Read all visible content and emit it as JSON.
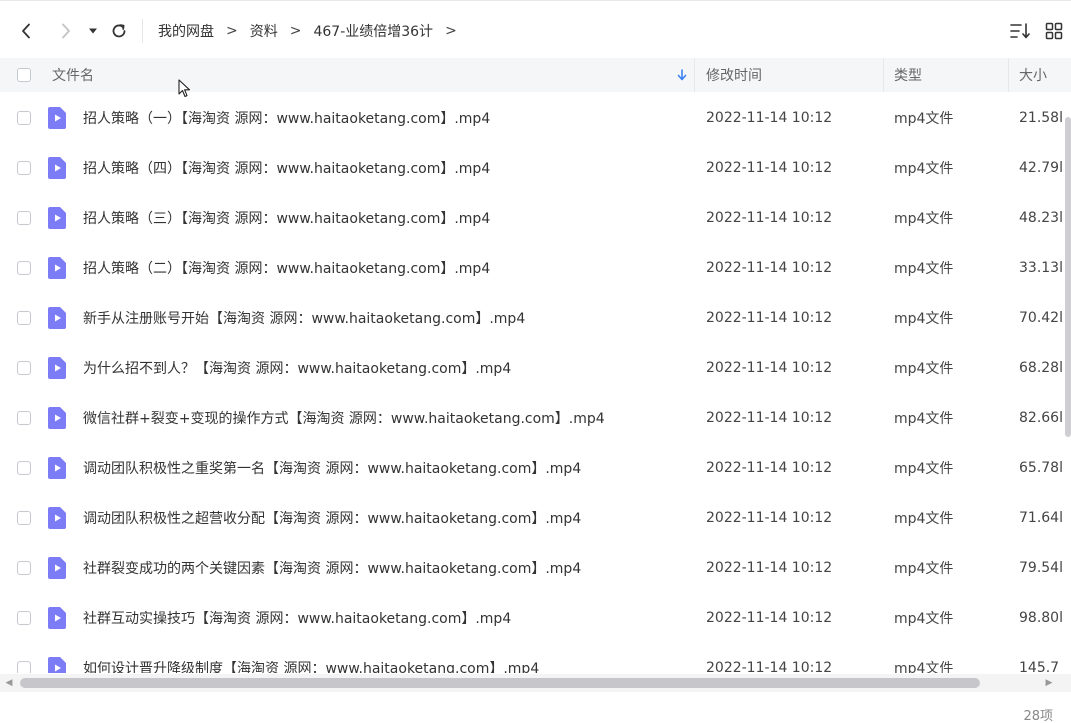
{
  "toolbar": {
    "breadcrumb": [
      "我的网盘",
      "资料",
      "467-业绩倍增36计"
    ],
    "separator": ">"
  },
  "columns": {
    "name": "文件名",
    "modified": "修改时间",
    "type": "类型",
    "size": "大小"
  },
  "files": [
    {
      "name": "招人策略（一）【海淘资 源网：www.haitaoketang.com】.mp4",
      "modified": "2022-11-14 10:12",
      "type": "mp4文件",
      "size": "21.58l"
    },
    {
      "name": "招人策略（四）【海淘资 源网：www.haitaoketang.com】.mp4",
      "modified": "2022-11-14 10:12",
      "type": "mp4文件",
      "size": "42.79l"
    },
    {
      "name": "招人策略（三）【海淘资 源网：www.haitaoketang.com】.mp4",
      "modified": "2022-11-14 10:12",
      "type": "mp4文件",
      "size": "48.23l"
    },
    {
      "name": "招人策略（二）【海淘资 源网：www.haitaoketang.com】.mp4",
      "modified": "2022-11-14 10:12",
      "type": "mp4文件",
      "size": "33.13l"
    },
    {
      "name": "新手从注册账号开始【海淘资 源网：www.haitaoketang.com】.mp4",
      "modified": "2022-11-14 10:12",
      "type": "mp4文件",
      "size": "70.42l"
    },
    {
      "name": "为什么招不到人？【海淘资 源网：www.haitaoketang.com】.mp4",
      "modified": "2022-11-14 10:12",
      "type": "mp4文件",
      "size": "68.28l"
    },
    {
      "name": "微信社群+裂变+变现的操作方式【海淘资 源网：www.haitaoketang.com】.mp4",
      "modified": "2022-11-14 10:12",
      "type": "mp4文件",
      "size": "82.66l"
    },
    {
      "name": "调动团队积极性之重奖第一名【海淘资 源网：www.haitaoketang.com】.mp4",
      "modified": "2022-11-14 10:12",
      "type": "mp4文件",
      "size": "65.78l"
    },
    {
      "name": "调动团队积极性之超营收分配【海淘资 源网：www.haitaoketang.com】.mp4",
      "modified": "2022-11-14 10:12",
      "type": "mp4文件",
      "size": "71.64l"
    },
    {
      "name": "社群裂变成功的两个关键因素【海淘资 源网：www.haitaoketang.com】.mp4",
      "modified": "2022-11-14 10:12",
      "type": "mp4文件",
      "size": "79.54l"
    },
    {
      "name": "社群互动实操技巧【海淘资 源网：www.haitaoketang.com】.mp4",
      "modified": "2022-11-14 10:12",
      "type": "mp4文件",
      "size": "98.80l"
    },
    {
      "name": "如何设计晋升降级制度【海淘资 源网：www.haitaoketang.com】.mp4",
      "modified": "2022-11-14 10:12",
      "type": "mp4文件",
      "size": "145.7"
    }
  ],
  "status": {
    "count": "28项"
  },
  "colors": {
    "accent": "#3b82f6",
    "file_icon": "#7c7cf6",
    "header_bg": "#f5f6f8"
  }
}
